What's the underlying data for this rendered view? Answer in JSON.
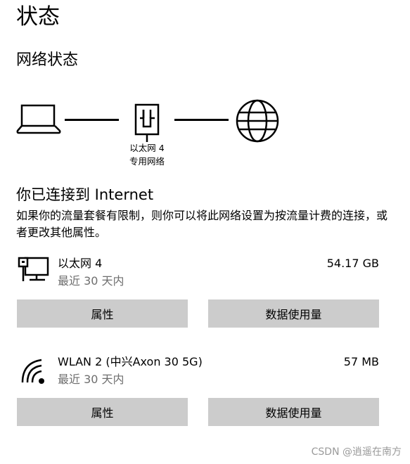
{
  "page": {
    "title": "状态",
    "section_title": "网络状态"
  },
  "diagram": {
    "nodes": [
      {
        "icon": "laptop-icon"
      },
      {
        "icon": "ethernet-adapter-icon",
        "label_line1": "以太网 4",
        "label_line2": "专用网络"
      },
      {
        "icon": "globe-icon"
      }
    ]
  },
  "status": {
    "heading": "你已连接到 Internet",
    "description": "如果你的流量套餐有限制，则你可以将此网络设置为按流量计费的连接，或者更改其他属性。"
  },
  "networks": [
    {
      "icon": "ethernet-monitor-icon",
      "name": "以太网 4",
      "period": "最近 30 天内",
      "usage": "54.17 GB",
      "properties_label": "属性",
      "data_usage_label": "数据使用量"
    },
    {
      "icon": "wifi-icon",
      "name": "WLAN 2 (中兴Axon 30 5G)",
      "period": "最近 30 天内",
      "usage": "57 MB",
      "properties_label": "属性",
      "data_usage_label": "数据使用量"
    }
  ],
  "watermark": "CSDN @逍遥在南方",
  "colors": {
    "button_bg": "#cccccc",
    "secondary_text": "#6e6e6e",
    "watermark": "#9a9a9a"
  }
}
